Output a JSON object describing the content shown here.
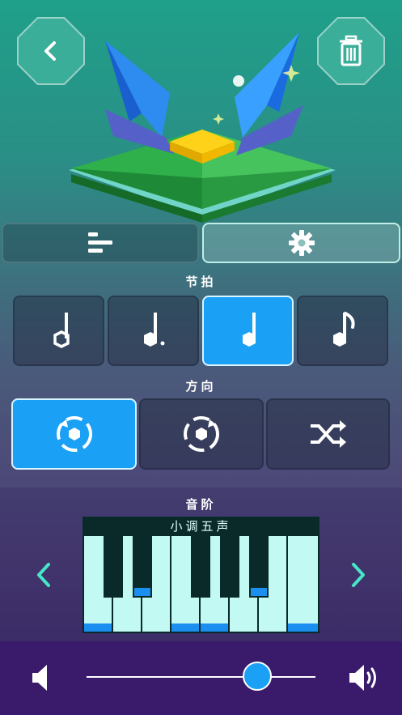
{
  "header": {
    "back_icon": "chevron-left-icon",
    "delete_icon": "trash-icon"
  },
  "tabs": [
    {
      "icon": "bars-icon",
      "active": false
    },
    {
      "icon": "gear-icon",
      "active": true
    }
  ],
  "rhythm": {
    "label": "节拍",
    "options": [
      {
        "icon": "half-note-icon",
        "selected": false
      },
      {
        "icon": "dotted-quarter-note-icon",
        "selected": false
      },
      {
        "icon": "quarter-note-icon",
        "selected": true
      },
      {
        "icon": "eighth-note-icon",
        "selected": false
      }
    ]
  },
  "direction": {
    "label": "方向",
    "options": [
      {
        "icon": "rotate-clockwise-icon",
        "selected": true
      },
      {
        "icon": "rotate-counterclockwise-icon",
        "selected": false
      },
      {
        "icon": "shuffle-icon",
        "selected": false
      }
    ]
  },
  "scale": {
    "label": "音阶",
    "name": "小调五声",
    "prev_icon": "chevron-left-icon",
    "next_icon": "chevron-right-icon"
  },
  "volume": {
    "level": 0.78,
    "low_icon": "speaker-low-icon",
    "high_icon": "speaker-high-icon"
  },
  "colors": {
    "accent": "#1aa0f5",
    "key_mark": "#1a8ff0",
    "white_key": "#c2f9f2"
  }
}
